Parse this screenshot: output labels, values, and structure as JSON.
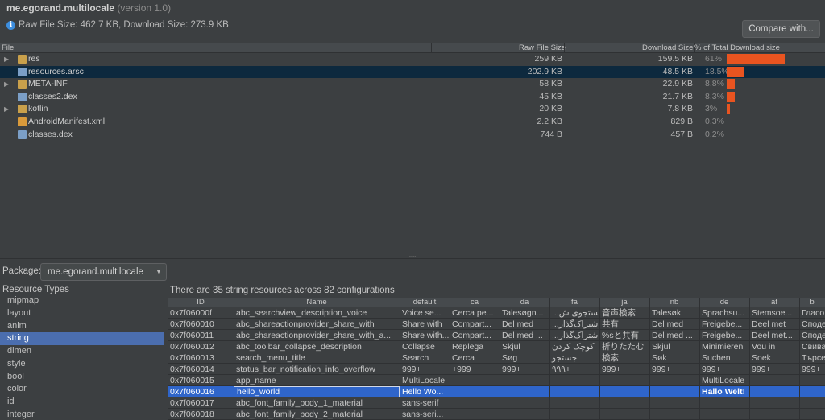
{
  "header": {
    "app_id": "me.egorand.multilocale",
    "version_text": "(version 1.0)",
    "size_summary": "Raw File Size: 462.7 KB, Download Size: 273.9 KB",
    "compare_button": "Compare with..."
  },
  "file_table": {
    "columns": {
      "file": "File",
      "raw": "Raw File Size",
      "download": "Download Size",
      "percent": "% of Total Download size"
    },
    "rows": [
      {
        "name": "res",
        "raw": "259 KB",
        "download": "159.5 KB",
        "percent": "61%",
        "share": 61,
        "type": "folder",
        "expandable": true
      },
      {
        "name": "resources.arsc",
        "raw": "202.9 KB",
        "download": "48.5 KB",
        "percent": "18.5%",
        "share": 18.5,
        "type": "file",
        "expandable": false
      },
      {
        "name": "META-INF",
        "raw": "58 KB",
        "download": "22.9 KB",
        "percent": "8.8%",
        "share": 8.8,
        "type": "folder",
        "expandable": true
      },
      {
        "name": "classes2.dex",
        "raw": "45 KB",
        "download": "21.7 KB",
        "percent": "8.3%",
        "share": 8.3,
        "type": "file",
        "expandable": false
      },
      {
        "name": "kotlin",
        "raw": "20 KB",
        "download": "7.8 KB",
        "percent": "3%",
        "share": 3,
        "type": "folder",
        "expandable": true
      },
      {
        "name": "AndroidManifest.xml",
        "raw": "2.2 KB",
        "download": "829 B",
        "percent": "0.3%",
        "share": 0.3,
        "type": "xml",
        "expandable": false
      },
      {
        "name": "classes.dex",
        "raw": "744 B",
        "download": "457 B",
        "percent": "0.2%",
        "share": 0.2,
        "type": "file",
        "expandable": false
      }
    ],
    "selected_row": 1,
    "bar_color": "#e95420"
  },
  "package": {
    "label": "Package:",
    "value": "me.egorand.multilocale"
  },
  "resource_types": {
    "title": "Resource Types",
    "items": [
      "mipmap",
      "layout",
      "anim",
      "string",
      "dimen",
      "style",
      "bool",
      "color",
      "id",
      "integer"
    ],
    "selected": "string"
  },
  "strings": {
    "summary": "There are 35 string resources across 82 configurations",
    "columns": [
      "ID",
      "Name",
      "default",
      "ca",
      "da",
      "fa",
      "ja",
      "nb",
      "de",
      "af",
      "b"
    ],
    "rows": [
      [
        "0x7f06000f",
        "abc_searchview_description_voice",
        "Voice se...",
        "Cerca pe...",
        "Talesøgn...",
        "...جستجوی ش",
        "音声検索",
        "Talesøk",
        "Sprachsu...",
        "Stemsoe...",
        "Гласо"
      ],
      [
        "0x7f060010",
        "abc_shareactionprovider_share_with",
        "Share with",
        "Compart...",
        "Del med",
        "...اشتراک‌گذار",
        "共有",
        "Del med",
        "Freigebe...",
        "Deel met",
        "Споде"
      ],
      [
        "0x7f060011",
        "abc_shareactionprovider_share_with_a...",
        "Share with...",
        "Compart...",
        "Del med ...",
        "...اشتراک‌گذار",
        "%sと共有",
        "Del med ...",
        "Freigebe...",
        "Deel met...",
        "Споде"
      ],
      [
        "0x7f060012",
        "abc_toolbar_collapse_description",
        "Collapse",
        "Replega",
        "Skjul",
        "کوچک کردن",
        "折りたたむ",
        "Skjul",
        "Minimieren",
        "Vou in",
        "Свива"
      ],
      [
        "0x7f060013",
        "search_menu_title",
        "Search",
        "Cerca",
        "Søg",
        "جستجو",
        "検索",
        "Søk",
        "Suchen",
        "Soek",
        "Търсе"
      ],
      [
        "0x7f060014",
        "status_bar_notification_info_overflow",
        "999+",
        "+999",
        "999+",
        "۹۹۹+",
        "999+",
        "999+",
        "999+",
        "999+",
        "999+"
      ],
      [
        "0x7f060015",
        "app_name",
        "MultiLocale",
        "",
        "",
        "",
        "",
        "",
        "MultiLocale",
        "",
        ""
      ],
      [
        "0x7f060016",
        "hello_world",
        "Hello Wo...",
        "",
        "",
        "",
        "",
        "",
        "Hallo Welt!",
        "",
        ""
      ],
      [
        "0x7f060017",
        "abc_font_family_body_1_material",
        "sans-serif",
        "",
        "",
        "",
        "",
        "",
        "",
        "",
        ""
      ],
      [
        "0x7f060018",
        "abc_font_family_body_2_material",
        "sans-seri...",
        "",
        "",
        "",
        "",
        "",
        "",
        "",
        ""
      ]
    ],
    "selected_row": 7
  }
}
